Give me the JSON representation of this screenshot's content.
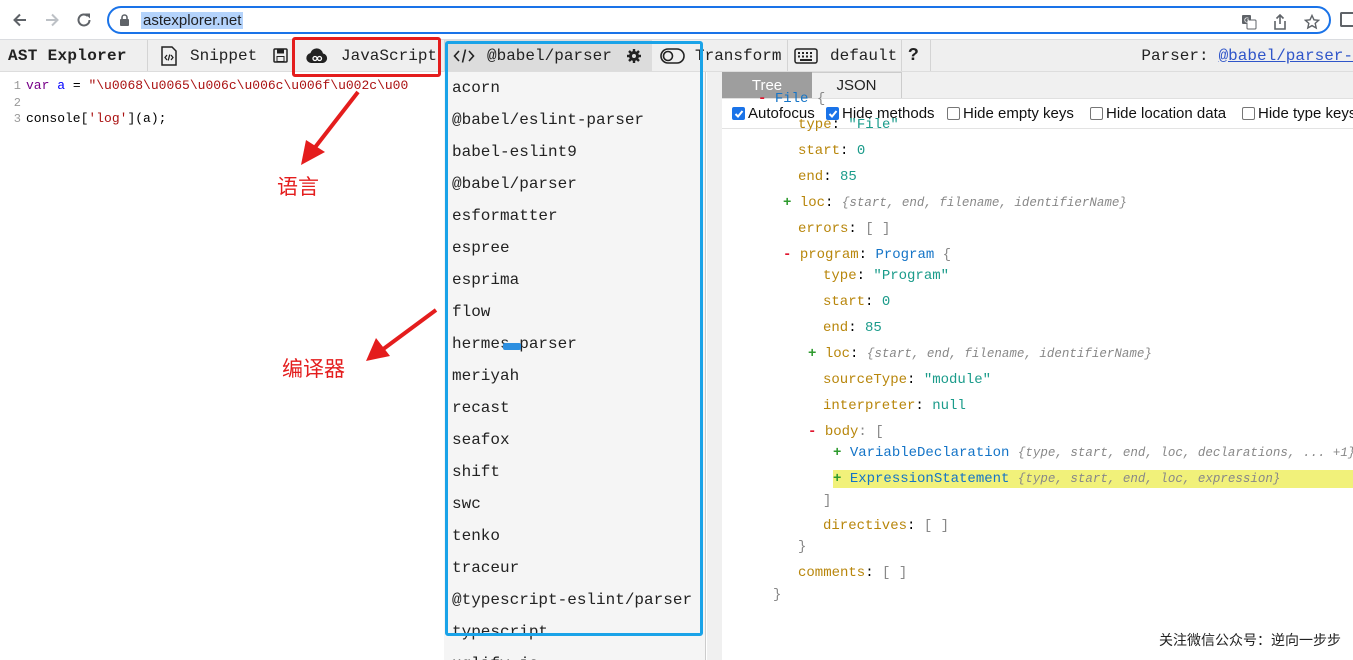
{
  "browser": {
    "url": "astexplorer.net"
  },
  "toolbar": {
    "title": "AST Explorer",
    "snippet_label": "Snippet",
    "language_label": "JavaScript",
    "parser_label": "@babel/parser",
    "transform_label": "Transform",
    "keymap_label": "default",
    "help_label": "?",
    "parser_info_label": "Parser:",
    "parser_info_link": "@babel/parser-"
  },
  "editor": {
    "lines": [
      {
        "num": "1",
        "tokens": [
          {
            "t": "var",
            "c": "kw"
          },
          {
            "t": " ",
            "c": ""
          },
          {
            "t": "a",
            "c": "def"
          },
          {
            "t": " = ",
            "c": ""
          },
          {
            "t": "\"\\u0068\\u0065\\u006c\\u006c\\u006f\\u002c\\u00",
            "c": "str"
          }
        ]
      },
      {
        "num": "2",
        "tokens": []
      },
      {
        "num": "3",
        "tokens": [
          {
            "t": "console[",
            "c": ""
          },
          {
            "t": "'log'",
            "c": "str"
          },
          {
            "t": "](a);",
            "c": ""
          }
        ]
      }
    ]
  },
  "parsers": [
    "acorn",
    "@babel/eslint-parser",
    "babel-eslint9",
    "@babel/parser",
    "esformatter",
    "espree",
    "esprima",
    "flow",
    "hermes-parser",
    "meriyah",
    "recast",
    "seafox",
    "shift",
    "swc",
    "tenko",
    "traceur",
    "@typescript-eslint/parser",
    "typescript",
    "uglify-js"
  ],
  "result": {
    "tabs": [
      "Tree",
      "JSON"
    ],
    "options": [
      {
        "label": "Autofocus",
        "checked": true
      },
      {
        "label": "Hide methods",
        "checked": true
      },
      {
        "label": "Hide empty keys",
        "checked": false
      },
      {
        "label": "Hide location data",
        "checked": false
      },
      {
        "label": "Hide type keys",
        "checked": false
      }
    ],
    "tree": [
      {
        "indent": 0,
        "toggle": "-",
        "parts": [
          {
            "t": "File",
            "c": "typename"
          },
          {
            "t": "  {",
            "c": "brace"
          }
        ]
      },
      {
        "indent": 1,
        "parts": [
          {
            "t": "type",
            "c": "key"
          },
          {
            "t": ": ",
            "c": ""
          },
          {
            "t": "\"File\"",
            "c": "strv"
          }
        ]
      },
      {
        "indent": 1,
        "parts": [
          {
            "t": "start",
            "c": "key"
          },
          {
            "t": ": ",
            "c": ""
          },
          {
            "t": "0",
            "c": "num"
          }
        ]
      },
      {
        "indent": 1,
        "parts": [
          {
            "t": "end",
            "c": "key"
          },
          {
            "t": ": ",
            "c": ""
          },
          {
            "t": "85",
            "c": "num"
          }
        ]
      },
      {
        "indent": 1,
        "toggle": "+",
        "parts": [
          {
            "t": "loc",
            "c": "key"
          },
          {
            "t": ": ",
            "c": ""
          },
          {
            "t": "{start, end, filename, identifierName}",
            "c": "summary"
          }
        ]
      },
      {
        "indent": 1,
        "parts": [
          {
            "t": "errors",
            "c": "key"
          },
          {
            "t": ": ",
            "c": ""
          },
          {
            "t": "[ ]",
            "c": "brace"
          }
        ]
      },
      {
        "indent": 1,
        "toggle": "-",
        "parts": [
          {
            "t": "program",
            "c": "key"
          },
          {
            "t": ": ",
            "c": ""
          },
          {
            "t": "Program",
            "c": "typename"
          },
          {
            "t": "  {",
            "c": "brace"
          }
        ]
      },
      {
        "indent": 2,
        "parts": [
          {
            "t": "type",
            "c": "key"
          },
          {
            "t": ": ",
            "c": ""
          },
          {
            "t": "\"Program\"",
            "c": "strv"
          }
        ]
      },
      {
        "indent": 2,
        "parts": [
          {
            "t": "start",
            "c": "key"
          },
          {
            "t": ": ",
            "c": ""
          },
          {
            "t": "0",
            "c": "num"
          }
        ]
      },
      {
        "indent": 2,
        "parts": [
          {
            "t": "end",
            "c": "key"
          },
          {
            "t": ": ",
            "c": ""
          },
          {
            "t": "85",
            "c": "num"
          }
        ]
      },
      {
        "indent": 2,
        "toggle": "+",
        "parts": [
          {
            "t": "loc",
            "c": "key"
          },
          {
            "t": ": ",
            "c": ""
          },
          {
            "t": "{start, end, filename, identifierName}",
            "c": "summary"
          }
        ]
      },
      {
        "indent": 2,
        "parts": [
          {
            "t": "sourceType",
            "c": "key"
          },
          {
            "t": ": ",
            "c": ""
          },
          {
            "t": "\"module\"",
            "c": "strv"
          }
        ]
      },
      {
        "indent": 2,
        "parts": [
          {
            "t": "interpreter",
            "c": "key"
          },
          {
            "t": ": ",
            "c": ""
          },
          {
            "t": "null",
            "c": "num"
          }
        ]
      },
      {
        "indent": 2,
        "toggle": "-",
        "parts": [
          {
            "t": "body",
            "c": "key"
          },
          {
            "t": ":  [",
            "c": "brace"
          }
        ]
      },
      {
        "indent": 3,
        "toggle": "+",
        "parts": [
          {
            "t": "VariableDeclaration",
            "c": "typename"
          },
          {
            "t": " ",
            "c": ""
          },
          {
            "t": "{type, start, end, loc, declarations, ... +1}",
            "c": "summary"
          }
        ]
      },
      {
        "indent": 3,
        "toggle": "+",
        "highlight": true,
        "parts": [
          {
            "t": "ExpressionStatement",
            "c": "typename"
          },
          {
            "t": " ",
            "c": ""
          },
          {
            "t": "{type, start, end, loc, expression}",
            "c": "summary"
          }
        ]
      },
      {
        "indent": 2,
        "parts": [
          {
            "t": "]",
            "c": "brace"
          }
        ]
      },
      {
        "indent": 2,
        "parts": [
          {
            "t": "directives",
            "c": "key"
          },
          {
            "t": ": ",
            "c": ""
          },
          {
            "t": "[ ]",
            "c": "brace"
          }
        ]
      },
      {
        "indent": 1,
        "parts": [
          {
            "t": "}",
            "c": "brace"
          }
        ]
      },
      {
        "indent": 1,
        "parts": [
          {
            "t": "comments",
            "c": "key"
          },
          {
            "t": ": ",
            "c": ""
          },
          {
            "t": "[ ]",
            "c": "brace"
          }
        ]
      },
      {
        "indent": 0,
        "parts": [
          {
            "t": "}",
            "c": "brace"
          }
        ]
      }
    ]
  },
  "annotations": {
    "language_label": "语言",
    "compiler_label": "编译器",
    "footer": "关注微信公众号：逆向一步步",
    "color": "#e41d1d",
    "dropdown_border_color": "#1aa3e8"
  }
}
